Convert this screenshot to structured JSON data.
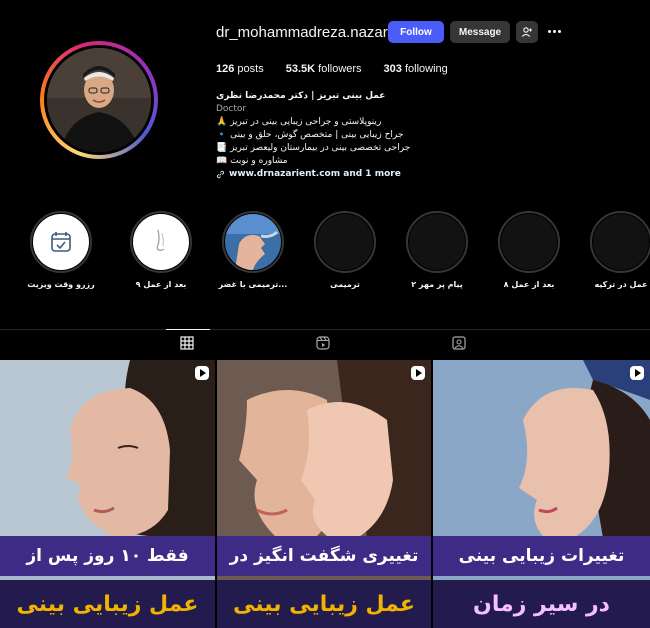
{
  "profile": {
    "username": "dr_mohammadreza.nazari",
    "follow_label": "Follow",
    "message_label": "Message",
    "stats": {
      "posts_count": "126",
      "posts_label": "posts",
      "followers_count": "53.5K",
      "followers_label": "followers",
      "following_count": "303",
      "following_label": "following"
    },
    "bio": {
      "name": "عمل بینی تبریز | دکتر محمدرضا نظری",
      "category": "Doctor",
      "lines": [
        "رینوپلاستی و جراحی زیبایی بینی در تبریز 🙏",
        "جراح زیبایی بینی | متخصص گوش، حلق و بینی 🔹",
        "جراحی تخصصی بینی در بیمارستان ولیعصر تبریز 📑",
        "مشاوره و نوبت 📖"
      ],
      "link_text": "www.drnazarient.com and 1 more"
    }
  },
  "highlights": [
    {
      "label": "عمل در ترکیه",
      "icon": "empty"
    },
    {
      "label": "بعد از عمل ۸",
      "icon": "empty"
    },
    {
      "label": "پیام پر مهر ۲",
      "icon": "empty"
    },
    {
      "label": "ترمیمی",
      "icon": "empty"
    },
    {
      "label": "...ترمیمی با غضر",
      "icon": "nose-photo"
    },
    {
      "label": "بعد از عمل ۹",
      "icon": "nose-sketch-icon"
    },
    {
      "label": "رزرو وقت ویزیت",
      "icon": "calendar-check-icon"
    }
  ],
  "tabs": [
    {
      "name": "posts-grid-icon",
      "active": true
    },
    {
      "name": "reels-icon",
      "active": false
    },
    {
      "name": "tagged-icon",
      "active": false
    }
  ],
  "posts": [
    {
      "line1": "فقط ۱۰ روز پس از",
      "line2": "عمل زیبایی بینی",
      "line2_color": "#f0b400"
    },
    {
      "line1": "تغییری شگفت انگیز در",
      "line2": "عمل زیبایی بینی",
      "line2_color": "#f0b400"
    },
    {
      "line1": "تغییرات زیبایی بینی",
      "line2": "در سیر زمان",
      "line2_color": "#f5c0ff"
    }
  ],
  "colors": {
    "follow_button": "#4a5df9",
    "secondary_button": "#363636",
    "caption_band_top": "#3d2b86",
    "caption_band_bottom": "#231a4d",
    "caption_accent": "#f0b400"
  }
}
